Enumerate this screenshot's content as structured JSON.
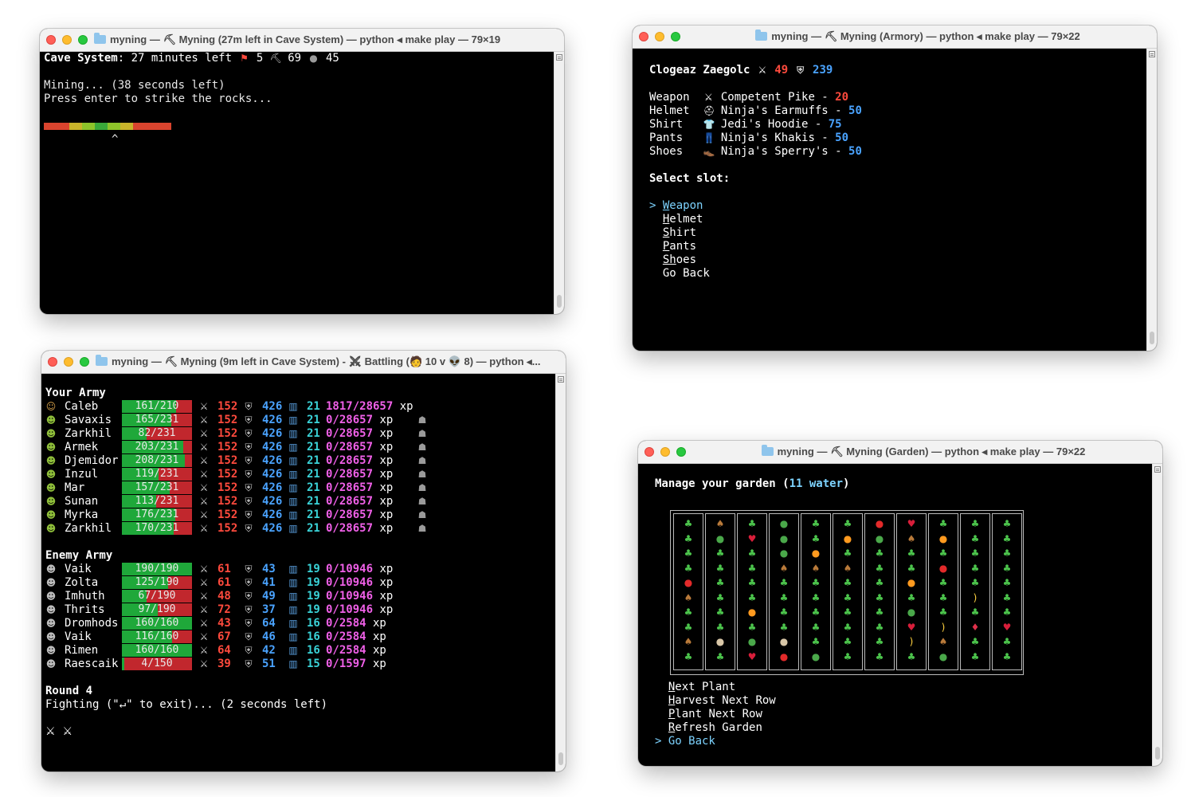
{
  "windows": {
    "mining": {
      "title_folder": "myning",
      "title_rest": "— ⛏ Myning (27m left in Cave System)  — python ◂ make play — 79×19",
      "status_location": "Cave System",
      "status_time": ": 27 minutes left",
      "flag_icon": "flag-icon",
      "flag_count": "5",
      "pick_count": "69",
      "helmet_count": "45",
      "mining_text": "Mining... (38 seconds left)",
      "prompt_text": "Press enter to strike the rocks...",
      "meter_colors": [
        "#d9442e",
        "#d9442e",
        "#c9b42a",
        "#8ec42a",
        "#3aa83a",
        "#8ec42a",
        "#c9b42a",
        "#d9442e",
        "#d9442e",
        "#d9442e"
      ],
      "caret": "^"
    },
    "armory": {
      "title_folder": "myning",
      "title_rest": "— ⛏ Myning (Armory)  — python ◂ make play — 79×22",
      "hero_name": "Clogeaz Zaegolc",
      "hero_attack": "49",
      "hero_defense": "239",
      "slots": [
        {
          "slot": "Weapon",
          "item": "Competent Pike",
          "value": "20",
          "color": "red",
          "icon": "⚔"
        },
        {
          "slot": "Helmet",
          "item": "Ninja's Earmuffs",
          "value": "50",
          "color": "blue",
          "icon": "⛑"
        },
        {
          "slot": "Shirt",
          "item": "Jedi's Hoodie",
          "value": "75",
          "color": "blue",
          "icon": "👕"
        },
        {
          "slot": "Pants",
          "item": "Ninja's Khakis",
          "value": "50",
          "color": "blue",
          "icon": "👖"
        },
        {
          "slot": "Shoes",
          "item": "Ninja's Sperry's",
          "value": "50",
          "color": "blue",
          "icon": "👞"
        }
      ],
      "select_label": "Select slot:",
      "menu": [
        {
          "first": "W",
          "rest": "eapon",
          "selected": true
        },
        {
          "first": "H",
          "rest": "elmet",
          "selected": false
        },
        {
          "first": "S",
          "rest": "hirt",
          "selected": false
        },
        {
          "first": "P",
          "rest": "ants",
          "selected": false
        },
        {
          "first": "Sh",
          "rest": "oes",
          "selected": false
        },
        {
          "first": "",
          "rest": "Go Back",
          "selected": false
        }
      ],
      "selector": ">"
    },
    "battle": {
      "title_folder": "myning",
      "title_rest": "— ⛏ Myning (9m left in Cave System) - ⚔ Battling (🧑 10 v 👽 8)  — python ◂...",
      "your_army_label": "Your Army",
      "enemy_army_label": "Enemy Army",
      "your_army": [
        {
          "name": "Caleb",
          "hp": "161/210",
          "fill": 0.77,
          "atk": "152",
          "def": "426",
          "lvl": "21",
          "xp": "1817/28657 xp",
          "dead": false,
          "hero": true
        },
        {
          "name": "Savaxis",
          "hp": "165/231",
          "fill": 0.71,
          "atk": "152",
          "def": "426",
          "lvl": "21",
          "xp": "0/28657 xp",
          "dead": true,
          "hero": false
        },
        {
          "name": "Zarkhil",
          "hp": "82/231",
          "fill": 0.35,
          "atk": "152",
          "def": "426",
          "lvl": "21",
          "xp": "0/28657 xp",
          "dead": true,
          "hero": false
        },
        {
          "name": "Armek",
          "hp": "203/231",
          "fill": 0.88,
          "atk": "152",
          "def": "426",
          "lvl": "21",
          "xp": "0/28657 xp",
          "dead": true,
          "hero": false
        },
        {
          "name": "Djemidor",
          "hp": "208/231",
          "fill": 0.9,
          "atk": "152",
          "def": "426",
          "lvl": "21",
          "xp": "0/28657 xp",
          "dead": true,
          "hero": false
        },
        {
          "name": "Inzul",
          "hp": "119/231",
          "fill": 0.52,
          "atk": "152",
          "def": "426",
          "lvl": "21",
          "xp": "0/28657 xp",
          "dead": true,
          "hero": false
        },
        {
          "name": "Mar",
          "hp": "157/231",
          "fill": 0.68,
          "atk": "152",
          "def": "426",
          "lvl": "21",
          "xp": "0/28657 xp",
          "dead": true,
          "hero": false
        },
        {
          "name": "Sunan",
          "hp": "113/231",
          "fill": 0.49,
          "atk": "152",
          "def": "426",
          "lvl": "21",
          "xp": "0/28657 xp",
          "dead": true,
          "hero": false
        },
        {
          "name": "Myrka",
          "hp": "176/231",
          "fill": 0.76,
          "atk": "152",
          "def": "426",
          "lvl": "21",
          "xp": "0/28657 xp",
          "dead": true,
          "hero": false
        },
        {
          "name": "Zarkhil",
          "hp": "170/231",
          "fill": 0.74,
          "atk": "152",
          "def": "426",
          "lvl": "21",
          "xp": "0/28657 xp",
          "dead": true,
          "hero": false
        }
      ],
      "enemy_army": [
        {
          "name": "Vaik",
          "hp": "190/190",
          "fill": 1.0,
          "atk": "61",
          "def": "43",
          "lvl": "19",
          "xp": "0/10946 xp"
        },
        {
          "name": "Zolta",
          "hp": "125/190",
          "fill": 0.66,
          "atk": "61",
          "def": "41",
          "lvl": "19",
          "xp": "0/10946 xp"
        },
        {
          "name": "Imhuth",
          "hp": "67/190",
          "fill": 0.35,
          "atk": "48",
          "def": "49",
          "lvl": "19",
          "xp": "0/10946 xp"
        },
        {
          "name": "Thrits",
          "hp": "97/190",
          "fill": 0.51,
          "atk": "72",
          "def": "37",
          "lvl": "19",
          "xp": "0/10946 xp"
        },
        {
          "name": "Dromhods",
          "hp": "160/160",
          "fill": 1.0,
          "atk": "43",
          "def": "64",
          "lvl": "16",
          "xp": "0/2584 xp"
        },
        {
          "name": "Vaik",
          "hp": "116/160",
          "fill": 0.72,
          "atk": "67",
          "def": "46",
          "lvl": "16",
          "xp": "0/2584 xp"
        },
        {
          "name": "Rimen",
          "hp": "160/160",
          "fill": 1.0,
          "atk": "64",
          "def": "42",
          "lvl": "16",
          "xp": "0/2584 xp"
        },
        {
          "name": "Raescaik",
          "hp": "4/150",
          "fill": 0.03,
          "atk": "39",
          "def": "51",
          "lvl": "15",
          "xp": "0/1597 xp"
        }
      ],
      "round_label": "Round 4",
      "fighting_text": "Fighting (\"↵\" to exit)... (2 seconds left)",
      "swords_footer": "⚔  ⚔"
    },
    "garden": {
      "title_folder": "myning",
      "title_rest": "— ⛏ Myning (Garden)  — python ◂ make play — 79×22",
      "heading_pre": "Manage your garden (",
      "water_count": "11 water",
      "heading_post": ")",
      "columns": [
        [
          "sprout",
          "sprout",
          "sprout",
          "sprout",
          "apple",
          "pot",
          "sprout",
          "sprout",
          "pot",
          "sprout"
        ],
        [
          "pot",
          "melon",
          "sprout",
          "sprout",
          "sprout",
          "sprout",
          "sprout",
          "sprout",
          "coconut",
          "sprout"
        ],
        [
          "sprout",
          "cherry",
          "sprout",
          "sprout",
          "sprout",
          "sprout",
          "orange",
          "sprout",
          "melon",
          "cherry"
        ],
        [
          "melon",
          "melon",
          "melon",
          "pot",
          "sprout",
          "sprout",
          "sprout",
          "sprout",
          "coconut",
          "apple"
        ],
        [
          "sprout",
          "sprout",
          "orange",
          "pot",
          "sprout",
          "sprout",
          "sprout",
          "sprout",
          "sprout",
          "melon"
        ],
        [
          "sprout",
          "orange",
          "sprout",
          "pot",
          "sprout",
          "sprout",
          "sprout",
          "sprout",
          "sprout",
          "sprout"
        ],
        [
          "apple",
          "melon",
          "sprout",
          "sprout",
          "sprout",
          "sprout",
          "sprout",
          "sprout",
          "sprout",
          "sprout"
        ],
        [
          "cherry",
          "pot",
          "sprout",
          "sprout",
          "orange",
          "sprout",
          "melon",
          "cherry",
          "banana",
          "sprout"
        ],
        [
          "sprout",
          "orange",
          "sprout",
          "apple",
          "sprout",
          "sprout",
          "sprout",
          "banana",
          "pot",
          "melon"
        ],
        [
          "sprout",
          "sprout",
          "sprout",
          "sprout",
          "sprout",
          "banana",
          "sprout",
          "straw",
          "sprout",
          "sprout"
        ],
        [
          "sprout",
          "sprout",
          "sprout",
          "sprout",
          "sprout",
          "sprout",
          "sprout",
          "cherry",
          "sprout",
          "sprout"
        ]
      ],
      "menu": [
        {
          "first": "N",
          "rest": "ext Plant",
          "selected": false
        },
        {
          "first": "H",
          "rest": "arvest Next Row",
          "selected": false
        },
        {
          "first": "P",
          "rest": "lant Next Row",
          "selected": false
        },
        {
          "first": "R",
          "rest": "efresh Garden",
          "selected": false
        },
        {
          "first": "",
          "rest": "Go Back",
          "selected": true
        }
      ],
      "selector": ">"
    }
  },
  "icons": {
    "sprout": "♣",
    "apple": "●",
    "cherry": "♥",
    "orange": "●",
    "pot": "♠",
    "melon": "●",
    "coconut": "●",
    "banana": ")",
    "straw": "♦"
  },
  "colors": {
    "red": "#ff4a3d",
    "blue": "#4aa3ff",
    "cyan": "#3ad3d8",
    "magenta": "#f060e8",
    "hp_green": "#1fa83a",
    "hp_red": "#c1272d",
    "highlight": "#7dd3ff"
  }
}
